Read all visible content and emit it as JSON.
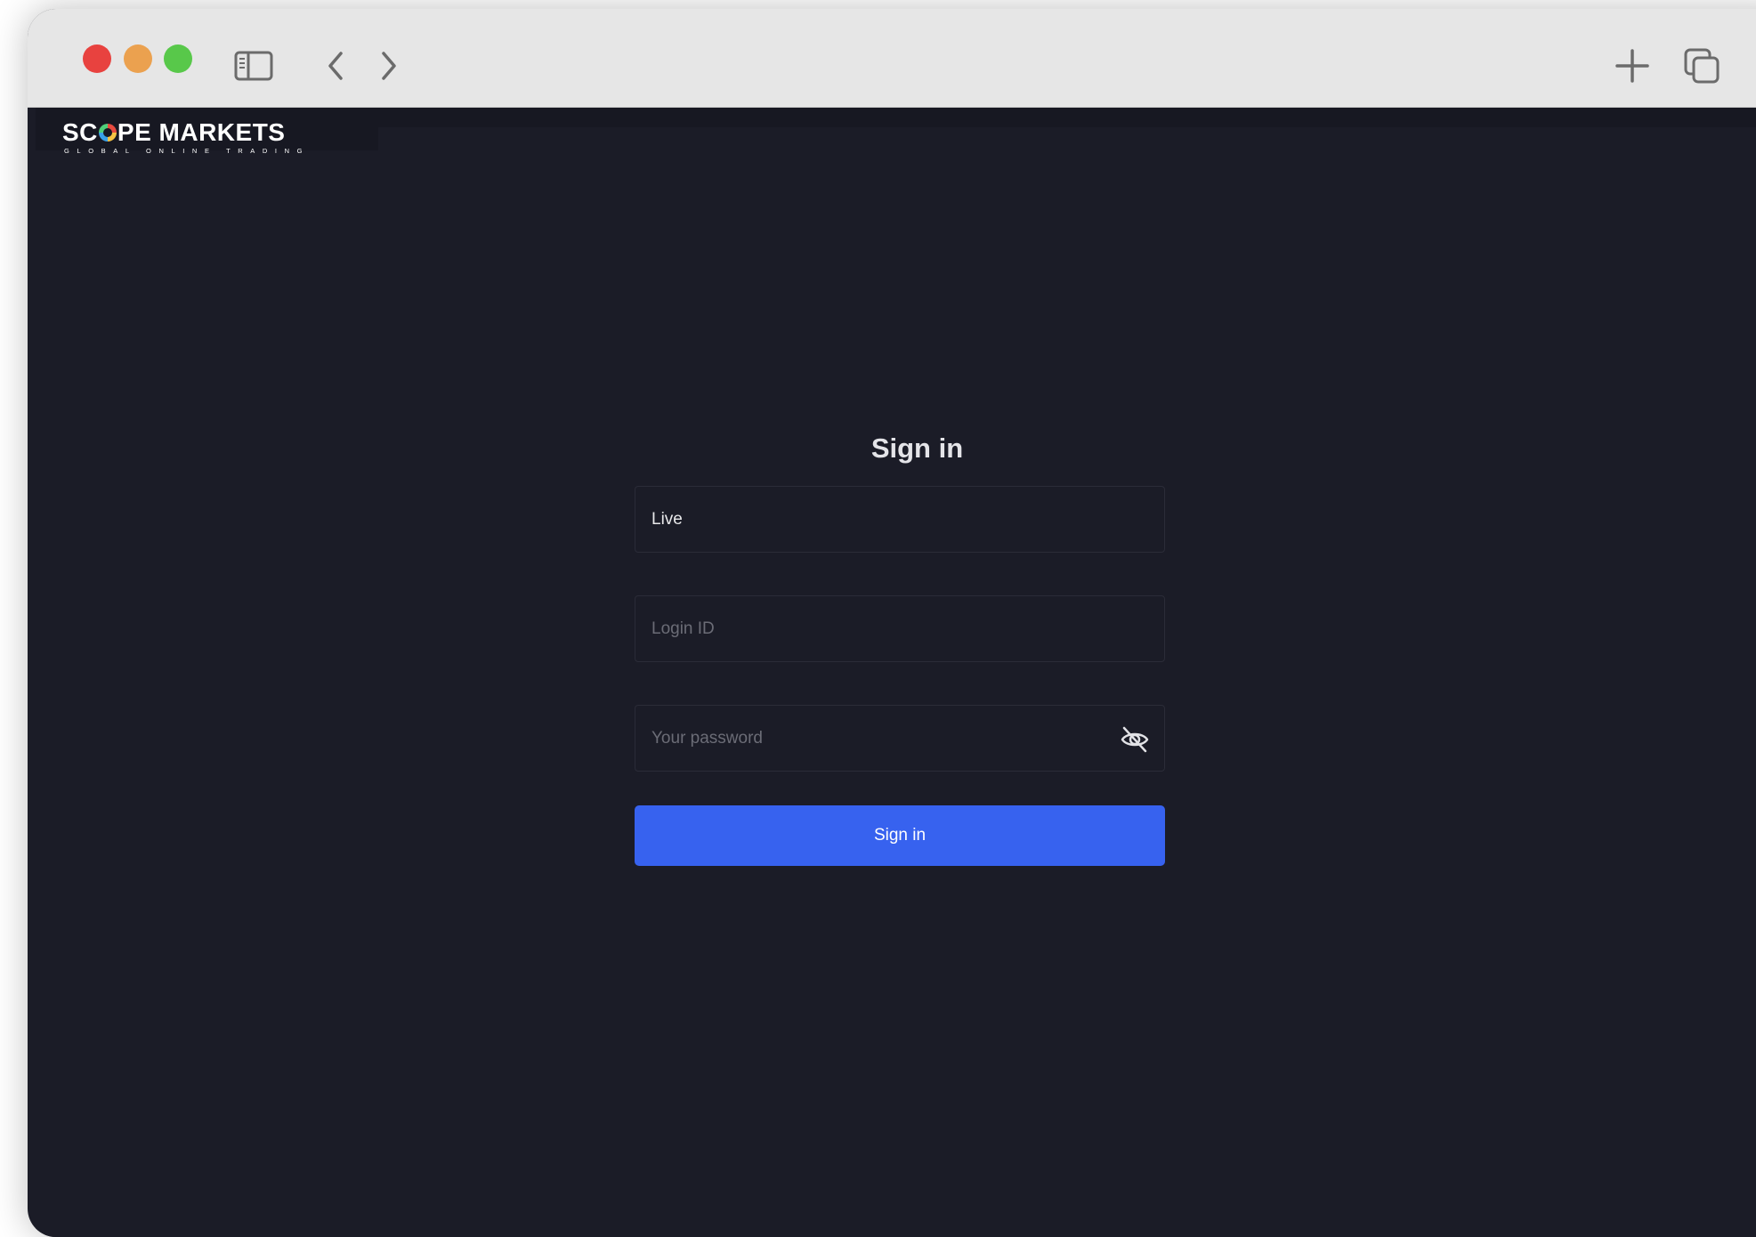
{
  "browser": {
    "icons": [
      "close-icon",
      "minimize-icon",
      "zoom-icon",
      "sidebar-icon",
      "back-icon",
      "forward-icon",
      "new-tab-icon",
      "tabs-overview-icon"
    ]
  },
  "brand": {
    "name_part1": "SC",
    "name_part2": "PE MARKETS",
    "tagline": "GLOBAL ONLINE TRADING"
  },
  "signin": {
    "title": "Sign in",
    "account_type_value": "Live",
    "login_placeholder": "Login ID",
    "password_placeholder": "Your password",
    "submit_label": "Sign in"
  },
  "colors": {
    "background": "#1b1c27",
    "accent": "#3762ef"
  }
}
